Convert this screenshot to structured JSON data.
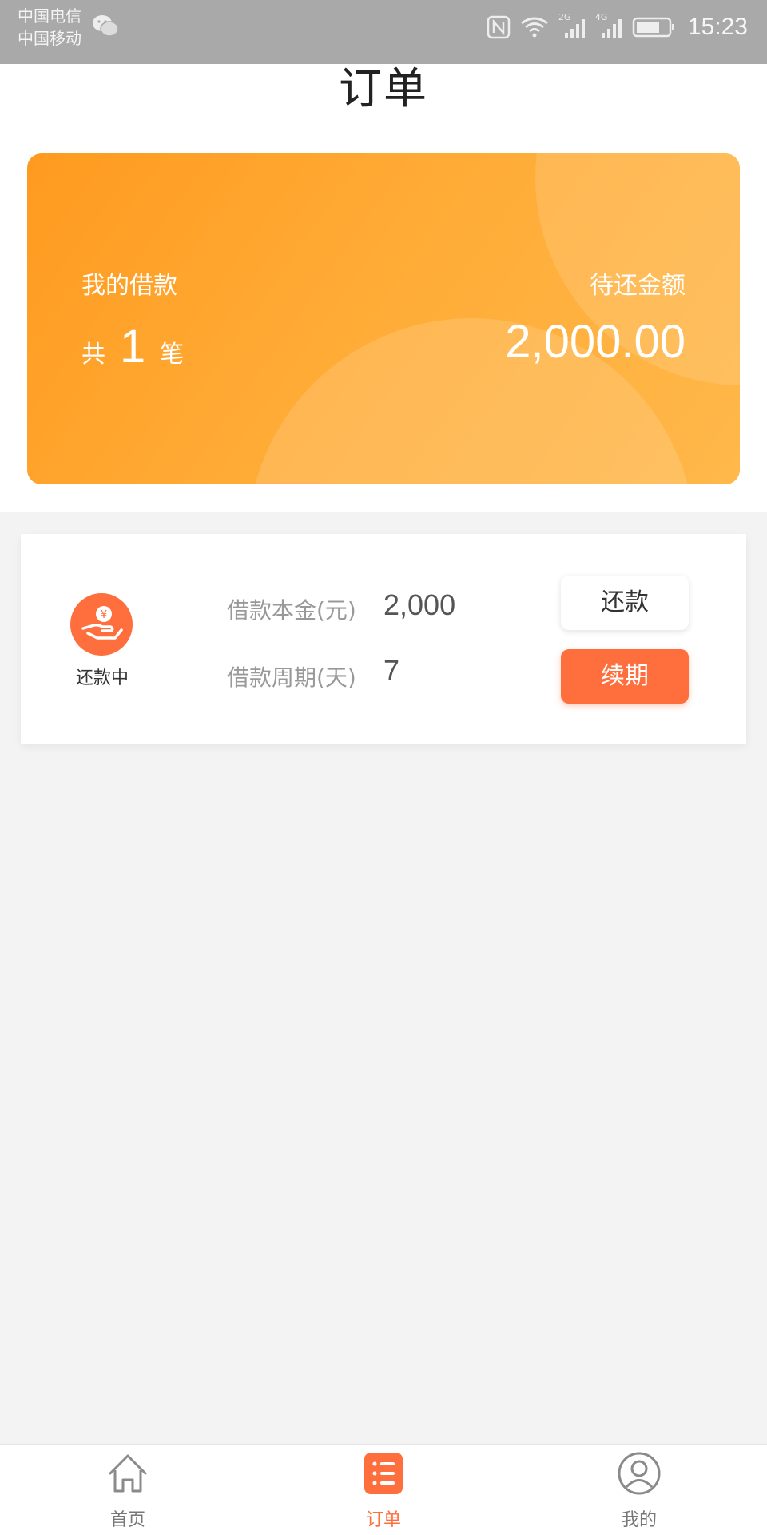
{
  "status_bar": {
    "carrier1": "中国电信",
    "carrier2": "中国移动",
    "signal1_tag": "2G",
    "signal2_tag": "4G",
    "time": "15:23",
    "icons": [
      "wechat-icon",
      "nfc-icon",
      "wifi-icon",
      "signal-icon",
      "signal-icon",
      "battery-icon"
    ]
  },
  "header": {
    "title": "订单"
  },
  "summary": {
    "my_loans_label": "我的借款",
    "count_prefix": "共",
    "count": "1",
    "count_suffix": "笔",
    "due_label": "待还金额",
    "due_amount": "2,000.00"
  },
  "order": {
    "status": "还款中",
    "principal_label": "借款本金(元)",
    "principal_value": "2,000",
    "period_label": "借款周期(天)",
    "period_value": "7",
    "repay_button": "还款",
    "renew_button": "续期"
  },
  "tabbar": {
    "items": [
      {
        "label": "首页",
        "icon": "home-icon",
        "active": false
      },
      {
        "label": "订单",
        "icon": "order-list-icon",
        "active": true
      },
      {
        "label": "我的",
        "icon": "user-icon",
        "active": false
      }
    ]
  },
  "colors": {
    "accent": "#ff6e3d",
    "card_gradient_start": "#ff9a1f",
    "card_gradient_end": "#ffb84a",
    "status_bar": "#a9a9a9"
  }
}
